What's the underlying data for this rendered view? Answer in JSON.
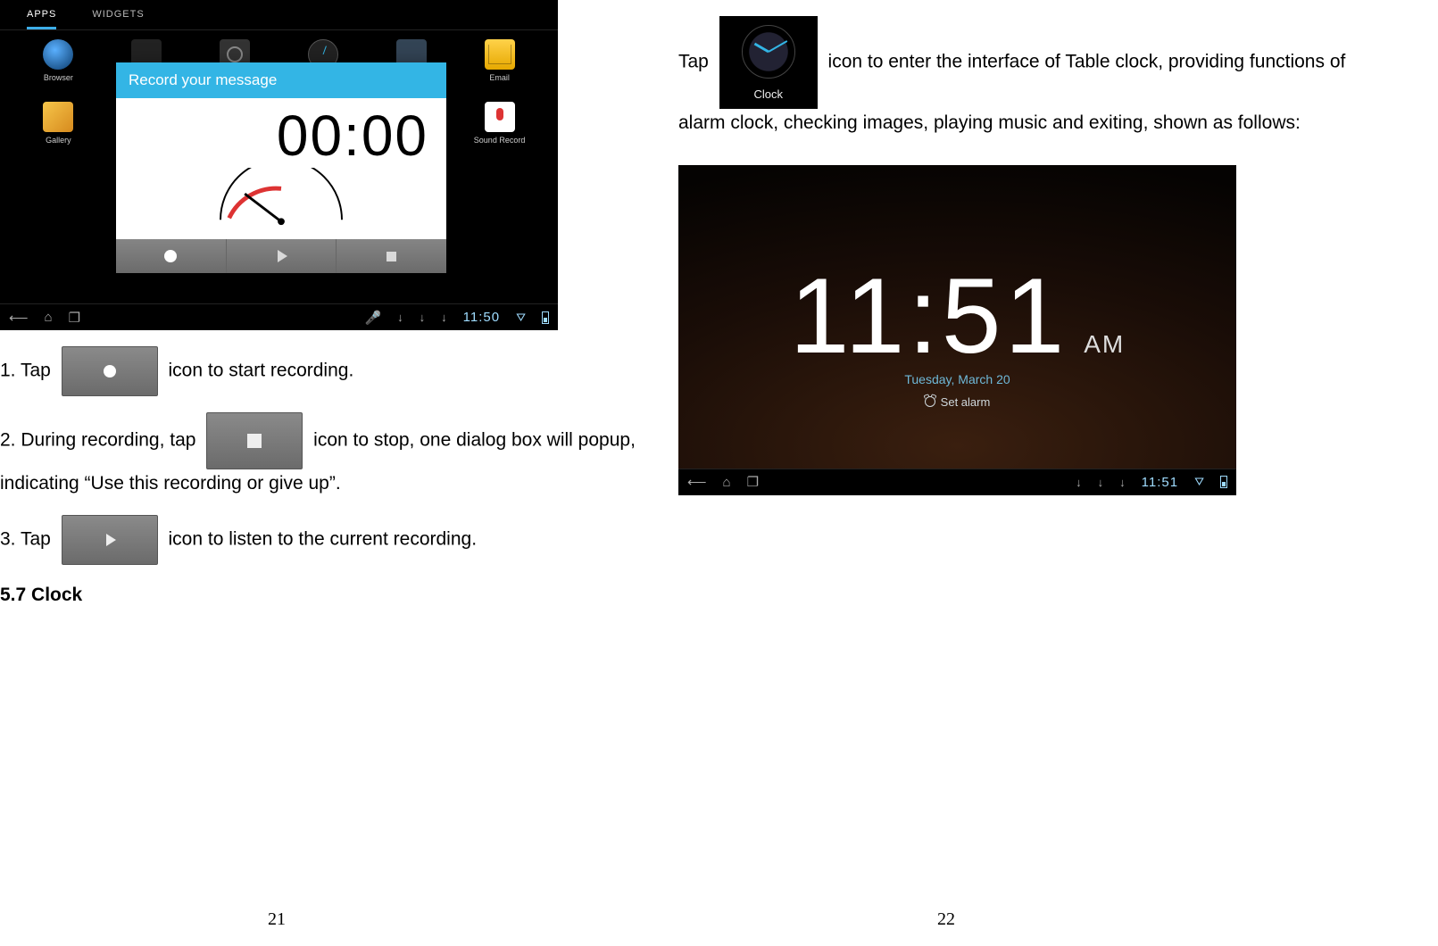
{
  "leftPage": {
    "screenshot1": {
      "tabs": {
        "apps": "APPS",
        "widgets": "WIDGETS"
      },
      "apps": {
        "browser": "Browser",
        "gallery": "Gallery",
        "email": "Email",
        "soundRecorder": "Sound Record"
      },
      "dialog": {
        "title": "Record your message",
        "time": "00:00"
      },
      "navbar": {
        "time": "11:50"
      }
    },
    "step1_a": "1. Tap",
    "step1_b": "icon to start recording.",
    "step2_a": "2. During recording, tap",
    "step2_b": "icon to stop, one dialog box will popup, indicating “Use this recording or give up”.",
    "step3_a": "3. Tap",
    "step3_b": "icon to listen to the current recording.",
    "section": "5.7 Clock",
    "pageNum": "21"
  },
  "rightPage": {
    "intro_a": "Tap",
    "intro_b": "icon to enter the interface of Table clock, providing functions of alarm clock, checking images, playing music and exiting, shown as follows:",
    "clockIconLabel": "Clock",
    "screenshot2": {
      "time": "11:51",
      "ampm": "AM",
      "date": "Tuesday, March 20",
      "setAlarm": "Set alarm",
      "navTime": "11:51"
    },
    "pageNum": "22"
  }
}
